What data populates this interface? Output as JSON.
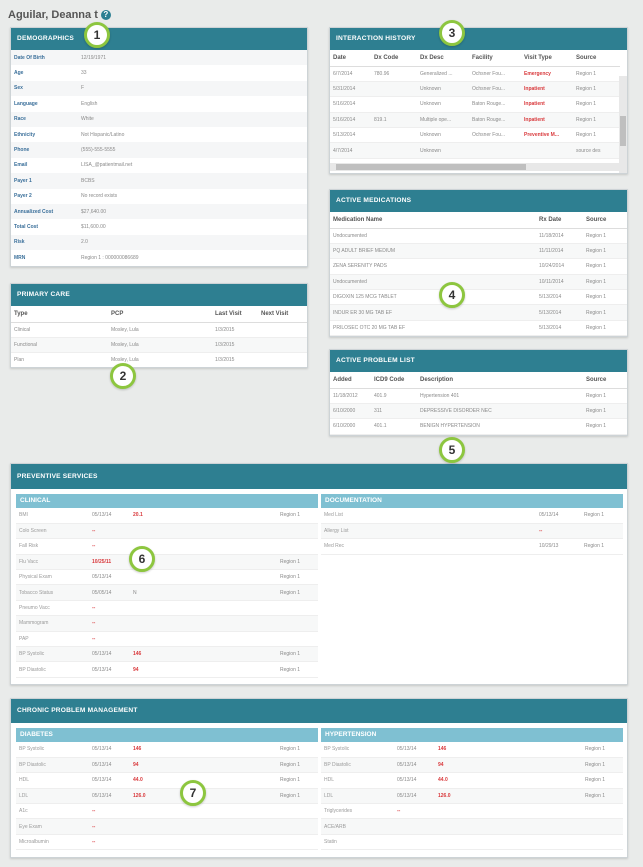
{
  "page": {
    "title": "Aguilar, Deanna t",
    "help_icon": "?"
  },
  "demographics": {
    "title": "DEMOGRAPHICS",
    "rows": [
      [
        "Date Of Birth",
        "12/19/1971"
      ],
      [
        "Age",
        "33"
      ],
      [
        "Sex",
        "F"
      ],
      [
        "Language",
        "English"
      ],
      [
        "Race",
        "White"
      ],
      [
        "Ethnicity",
        "Not Hispanic/Latino"
      ],
      [
        "Phone",
        "(555)-555-5555"
      ],
      [
        "Email",
        "LISA_@patientmail.net"
      ],
      [
        "Payer 1",
        "BCBS"
      ],
      [
        "Payer 2",
        "No record exists"
      ],
      [
        "Annualized Cost",
        "$27,640.00"
      ],
      [
        "Total Cost",
        "$11,600.00"
      ],
      [
        "Risk",
        "2.0"
      ],
      [
        "MRN",
        "Region 1 : 000000086689"
      ]
    ]
  },
  "primary_care": {
    "title": "PRIMARY CARE",
    "headers": [
      "Type",
      "PCP",
      "Last Visit",
      "Next Visit"
    ],
    "rows": [
      [
        "Clinical",
        "Mosley, Lula",
        "1/3/2015",
        ""
      ],
      [
        "Functional",
        "Mosley, Lula",
        "1/3/2015",
        ""
      ],
      [
        "Plan",
        "Mosley, Lula",
        "1/3/2015",
        ""
      ]
    ]
  },
  "interaction_history": {
    "title": "INTERACTION HISTORY",
    "headers": [
      "Date",
      "Dx Code",
      "Dx Desc",
      "Facility",
      "Visit Type",
      "Source"
    ],
    "rows": [
      [
        "6/7/2014",
        "780.96",
        "Generalized ...",
        "Ochsner Fou...",
        "Emergency",
        "Region 1"
      ],
      [
        "5/31/2014",
        "",
        "Unknown",
        "Ochsner Fou...",
        "Inpatient",
        "Region 1"
      ],
      [
        "5/16/2014",
        "",
        "Unknown",
        "Baton Rouge...",
        "Inpatient",
        "Region 1"
      ],
      [
        "5/16/2014",
        "819.1",
        "Multiple ope...",
        "Baton Rouge...",
        "Inpatient",
        "Region 1"
      ],
      [
        "5/13/2014",
        "",
        "Unknown",
        "Ochsner Fou...",
        "Preventive M...",
        "Region 1"
      ],
      [
        "4/7/2014",
        "",
        "Unknown",
        "",
        "",
        "source des"
      ]
    ]
  },
  "medications": {
    "title": "ACTIVE MEDICATIONS",
    "headers": [
      "Medication Name",
      "Rx Date",
      "Source"
    ],
    "rows": [
      [
        "Undocumented",
        "11/18/2014",
        "Region 1"
      ],
      [
        "PQ ADULT BRIEF MEDIUM",
        "11/11/2014",
        "Region 1"
      ],
      [
        "ZENA SERENITY PADS",
        "10/24/2014",
        "Region 1"
      ],
      [
        "Undocumented",
        "10/11/2014",
        "Region 1"
      ],
      [
        "DIGOXIN 125 MCG TABLET",
        "5/13/2014",
        "Region 1"
      ],
      [
        "INDUR ER 30 MG TAB EF",
        "5/13/2014",
        "Region 1"
      ],
      [
        "PRILOSEC OTC 20 MG TAB EF",
        "5/13/2014",
        "Region 1"
      ]
    ]
  },
  "problems": {
    "title": "ACTIVE PROBLEM LIST",
    "headers": [
      "Added",
      "ICD9 Code",
      "Description",
      "Source"
    ],
    "rows": [
      [
        "11/18/2012",
        "401.9",
        "Hypertension 401",
        "Region 1"
      ],
      [
        "6/10/2000",
        "311",
        "DEPRESSIVE DISORDER NEC",
        "Region 1"
      ],
      [
        "6/10/2000",
        "401.1",
        "BENIGN HYPERTENSION",
        "Region 1"
      ]
    ]
  },
  "preventive": {
    "title": "PREVENTIVE SERVICES",
    "clinical": {
      "title": "CLINICAL",
      "rows": [
        [
          "BMI",
          "05/13/14",
          "20.1",
          "Region 1"
        ],
        [
          "Colo Screen",
          "--",
          "",
          ""
        ],
        [
          "Fall Risk",
          "--",
          "",
          ""
        ],
        [
          "Flu Vacc",
          "10/25/11",
          "",
          "Region 1"
        ],
        [
          "Physical Exam",
          "05/13/14",
          "",
          "Region 1"
        ],
        [
          "Tobacco Status",
          "05/05/14",
          "N",
          "Region 1"
        ],
        [
          "Pneumo Vacc",
          "--",
          "",
          ""
        ],
        [
          "Mammogram",
          "--",
          "",
          ""
        ],
        [
          "PAP",
          "--",
          "",
          ""
        ],
        [
          "BP Systolic",
          "05/13/14",
          "146",
          "Region 1"
        ],
        [
          "BP Diastolic",
          "05/13/14",
          "94",
          "Region 1"
        ]
      ]
    },
    "documentation": {
      "title": "DOCUMENTATION",
      "rows": [
        [
          "Med List",
          "05/13/14",
          "Region 1"
        ],
        [
          "Allergy List",
          "--",
          ""
        ],
        [
          "Med Rec",
          "10/29/13",
          "Region 1"
        ]
      ]
    }
  },
  "chronic": {
    "title": "CHRONIC PROBLEM MANAGEMENT",
    "diabetes": {
      "title": "DIABETES",
      "rows": [
        [
          "BP Systolic",
          "05/13/14",
          "146",
          "Region 1"
        ],
        [
          "BP Diastolic",
          "05/13/14",
          "94",
          "Region 1"
        ],
        [
          "HDL",
          "05/13/14",
          "44.0",
          "Region 1"
        ],
        [
          "LDL",
          "05/13/14",
          "126.0",
          "Region 1"
        ],
        [
          "A1c",
          "--",
          "",
          ""
        ],
        [
          "Eye Exam",
          "--",
          "",
          ""
        ],
        [
          "Microalbumin",
          "--",
          "",
          ""
        ]
      ]
    },
    "hypertension": {
      "title": "HYPERTENSION",
      "rows": [
        [
          "BP Systolic",
          "05/13/14",
          "146",
          "Region 1"
        ],
        [
          "BP Diastolic",
          "05/13/14",
          "94",
          "Region 1"
        ],
        [
          "HDL",
          "05/13/14",
          "44.0",
          "Region 1"
        ],
        [
          "LDL",
          "05/13/14",
          "126.0",
          "Region 1"
        ],
        [
          "Triglycerides",
          "--",
          "",
          ""
        ],
        [
          "ACE/ARB",
          "",
          "",
          " "
        ],
        [
          "Statin",
          "",
          "",
          ""
        ]
      ]
    }
  },
  "callouts": [
    "1",
    "2",
    "3",
    "4",
    "5",
    "6",
    "7"
  ]
}
